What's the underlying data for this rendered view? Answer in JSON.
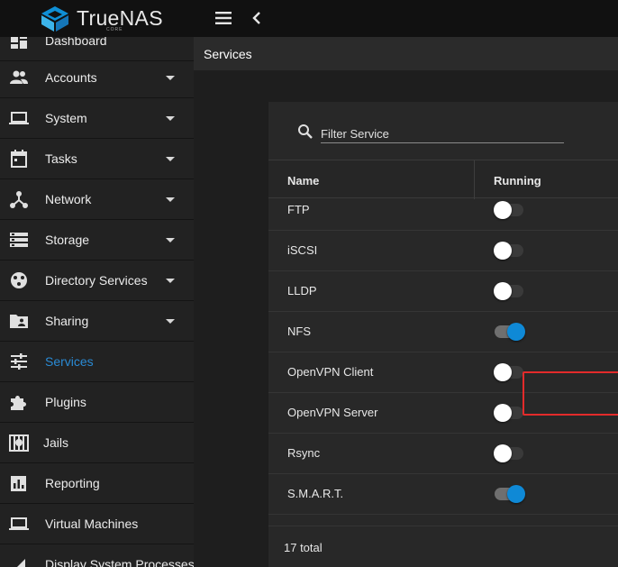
{
  "brand": {
    "name": "TrueNAS",
    "edition": "CORE"
  },
  "page": {
    "title": "Services"
  },
  "sidebar": {
    "items": [
      {
        "label": "Dashboard",
        "icon": "dashboard-icon",
        "expandable": false
      },
      {
        "label": "Accounts",
        "icon": "accounts-icon",
        "expandable": true
      },
      {
        "label": "System",
        "icon": "laptop-icon",
        "expandable": true
      },
      {
        "label": "Tasks",
        "icon": "calendar-icon",
        "expandable": true
      },
      {
        "label": "Network",
        "icon": "network-icon",
        "expandable": true
      },
      {
        "label": "Storage",
        "icon": "storage-icon",
        "expandable": true
      },
      {
        "label": "Directory Services",
        "icon": "directory-services-icon",
        "expandable": true
      },
      {
        "label": "Sharing",
        "icon": "folder-shared-icon",
        "expandable": true
      },
      {
        "label": "Services",
        "icon": "tune-icon",
        "expandable": false,
        "active": true
      },
      {
        "label": "Plugins",
        "icon": "puzzle-icon",
        "expandable": false
      },
      {
        "label": "Jails",
        "icon": "jail-icon",
        "expandable": false
      },
      {
        "label": "Reporting",
        "icon": "chart-icon",
        "expandable": false
      },
      {
        "label": "Virtual Machines",
        "icon": "laptop-icon",
        "expandable": false
      },
      {
        "label": "Display System Processes",
        "icon": "processes-icon",
        "expandable": false
      }
    ]
  },
  "filter": {
    "placeholder": "Filter Service",
    "value": ""
  },
  "table": {
    "columns": [
      "Name",
      "Running"
    ],
    "rows": [
      {
        "name": "FTP",
        "running": false
      },
      {
        "name": "iSCSI",
        "running": false
      },
      {
        "name": "LLDP",
        "running": false
      },
      {
        "name": "NFS",
        "running": true
      },
      {
        "name": "OpenVPN Client",
        "running": false
      },
      {
        "name": "OpenVPN Server",
        "running": false
      },
      {
        "name": "Rsync",
        "running": false
      },
      {
        "name": "S.M.A.R.T.",
        "running": true
      }
    ],
    "total": "17 total"
  },
  "colors": {
    "accent": "#0f89d6",
    "highlight": "#e32b2b",
    "active_nav": "#2a8ad4"
  }
}
